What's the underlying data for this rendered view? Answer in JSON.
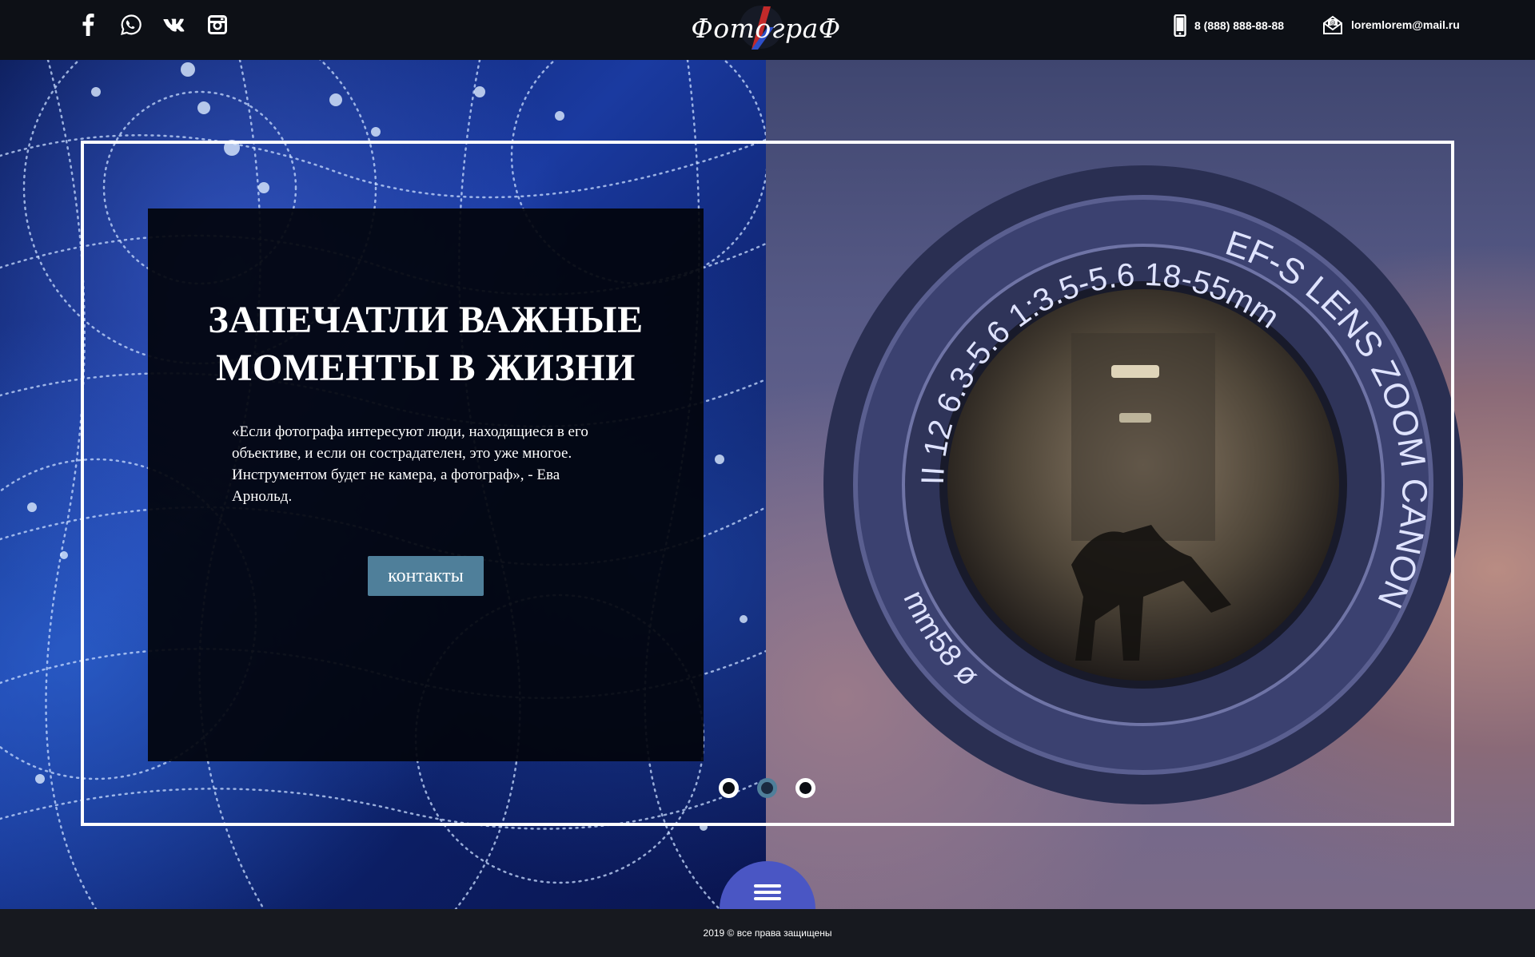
{
  "header": {
    "social": [
      {
        "icon": "facebook-icon"
      },
      {
        "icon": "whatsapp-icon"
      },
      {
        "icon": "vk-icon"
      },
      {
        "icon": "instagram-icon"
      }
    ],
    "logo_text": "ФотограФ",
    "phone": "8 (888) 888-88-88",
    "email": "loremlorem@mail.ru"
  },
  "hero": {
    "headline_line1": "ЗАПЕЧАТЛИ ВАЖНЫЕ",
    "headline_line2": "МОМЕНТЫ В ЖИЗНИ",
    "quote": "«Если фотографа интересуют люди, находящиеся в его объективе, и если он сострадателен, это уже многое. Инструментом будет не камера, а фотограф», - Ева Арнольд.",
    "cta_label": "контакты",
    "lens_text_top": "II 12 6.3-5.6 1:3.5-5.6 18-55mm",
    "lens_text_right": "EF-S LENS ZOOM CANON",
    "lens_text_bottom": "mm58 ø",
    "slides": 3,
    "active_slide": 2
  },
  "footer": {
    "text": "2019 © все права защищены"
  },
  "colors": {
    "accent": "#4f7f9a",
    "menu_button": "#4a56c4",
    "header_bg": "#0d1016",
    "footer_bg": "#17191f"
  }
}
